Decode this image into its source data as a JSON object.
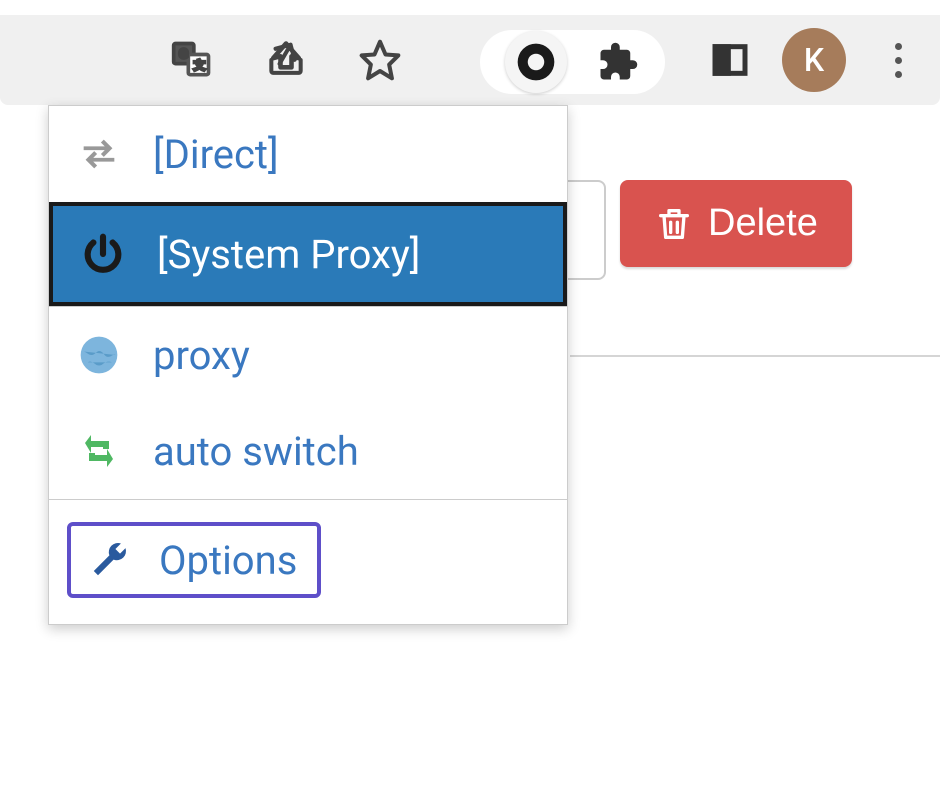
{
  "toolbar": {
    "avatar_letter": "K"
  },
  "menu": {
    "direct": "[Direct]",
    "system_proxy": "[System Proxy]",
    "proxy": "proxy",
    "auto_switch": "auto switch",
    "options": "Options"
  },
  "buttons": {
    "delete": "Delete"
  }
}
